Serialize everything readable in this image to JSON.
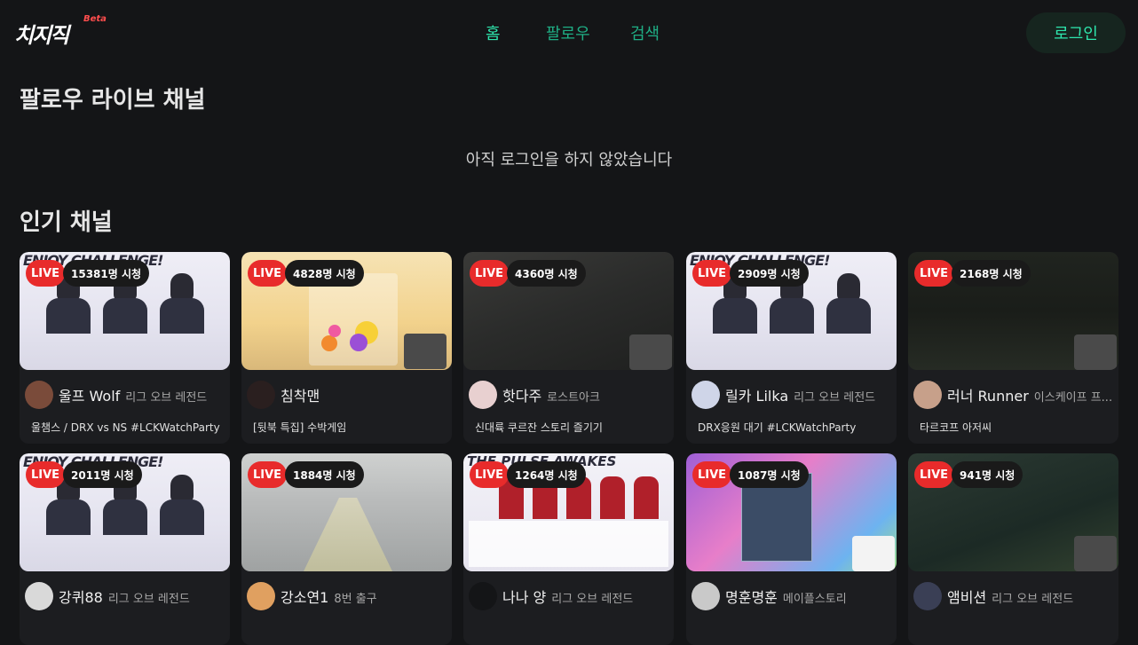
{
  "header": {
    "logo_text": "치지직",
    "beta_label": "Beta",
    "nav": {
      "home": "홈",
      "follow": "팔로우",
      "search": "검색"
    },
    "login_label": "로그인"
  },
  "follow_section": {
    "title": "팔로우 라이브 채널",
    "empty_message": "아직 로그인을 하지 않았습니다"
  },
  "popular_section": {
    "title": "인기 채널",
    "channels": [
      {
        "live": "LIVE",
        "viewers": "15381명 시청",
        "name": "울프 Wolf",
        "category": "리그 오브 레전드",
        "title": "울챔스 / DRX vs NS #LCKWatchParty",
        "thumb": "lck"
      },
      {
        "live": "LIVE",
        "viewers": "4828명 시청",
        "name": "침착맨",
        "category": "",
        "title": "[뒷북 특집] 수박게임",
        "thumb": "game-bright"
      },
      {
        "live": "LIVE",
        "viewers": "4360명 시청",
        "name": "핫다주",
        "category": "로스트아크",
        "title": "신대륙 쿠르잔 스토리 즐기기",
        "thumb": "game-dark"
      },
      {
        "live": "LIVE",
        "viewers": "2909명 시청",
        "name": "릴카 Lilka",
        "category": "리그 오브 레전드",
        "title": "DRX응원 대기 #LCKWatchParty",
        "thumb": "lck"
      },
      {
        "live": "LIVE",
        "viewers": "2168명 시청",
        "name": "러너 Runner",
        "category": "이스케이프 프...",
        "title": "타르코프 아저씨",
        "thumb": "shooter"
      },
      {
        "live": "LIVE",
        "viewers": "2011명 시청",
        "name": "강퀴88",
        "category": "리그 오브 레전드",
        "title": "",
        "thumb": "lck"
      },
      {
        "live": "LIVE",
        "viewers": "1884명 시청",
        "name": "강소연1",
        "category": "8번 출구",
        "title": "",
        "thumb": "hallway"
      },
      {
        "live": "LIVE",
        "viewers": "1264명 시청",
        "name": "나나 양",
        "category": "리그 오브 레전드",
        "title": "",
        "thumb": "lck2"
      },
      {
        "live": "LIVE",
        "viewers": "1087명 시청",
        "name": "명훈명훈",
        "category": "메이플스토리",
        "title": "",
        "thumb": "maple"
      },
      {
        "live": "LIVE",
        "viewers": "941명 시청",
        "name": "앰비션",
        "category": "리그 오브 레전드",
        "title": "",
        "thumb": "lol"
      }
    ]
  },
  "thumb_text": {
    "lck_banner": "ENJOY CHALLENGE!",
    "lck2_banner": "THE PULSE AWAKES"
  },
  "colors": {
    "background": "#141517",
    "accent": "#2ee6ad",
    "live_red": "#e82b2b",
    "card_bg": "#1c1d20"
  }
}
